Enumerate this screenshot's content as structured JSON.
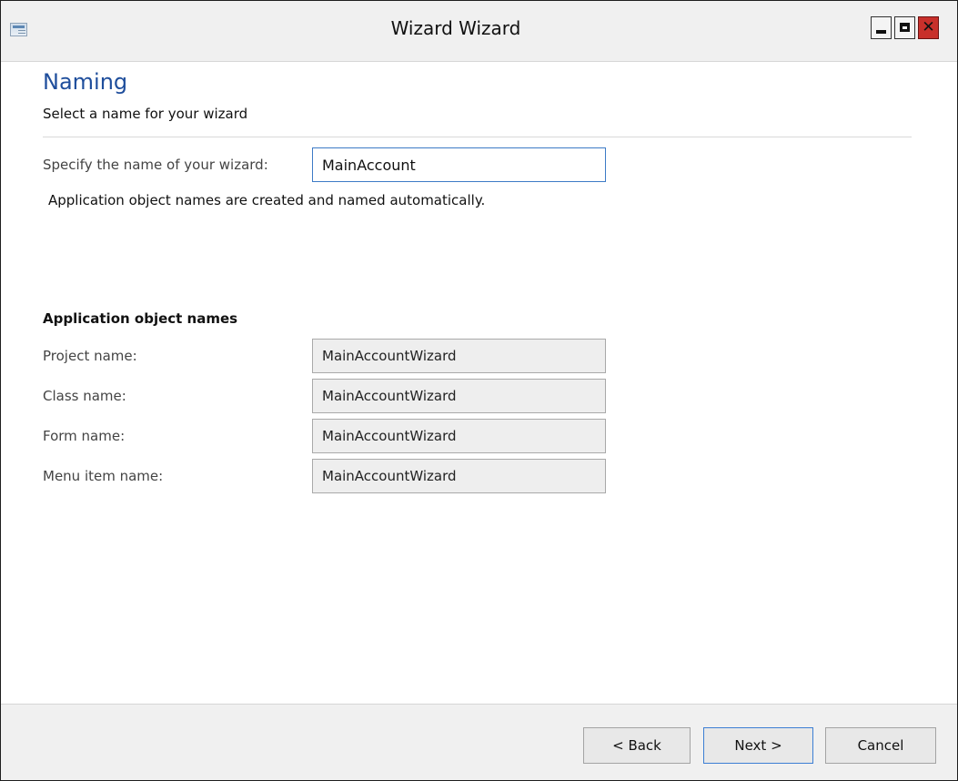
{
  "window": {
    "title": "Wizard Wizard",
    "controls": {
      "minimize_icon": "minimize-icon",
      "maximize_icon": "maximize-icon",
      "close_icon": "close-icon",
      "close_glyph": "✕",
      "close_color": "#c8302b"
    }
  },
  "page": {
    "heading": "Naming",
    "subheading": "Select a name for your wizard",
    "heading_color": "#1f4e9c"
  },
  "name_field": {
    "label": "Specify the name of your wizard:",
    "value": "MainAccount"
  },
  "info_text": "Application object names are created and named automatically.",
  "object_names": {
    "title": "Application object names",
    "fields": [
      {
        "label": "Project name:",
        "value": "MainAccountWizard"
      },
      {
        "label": "Class name:",
        "value": "MainAccountWizard"
      },
      {
        "label": "Form name:",
        "value": "MainAccountWizard"
      },
      {
        "label": "Menu item name:",
        "value": "MainAccountWizard"
      }
    ]
  },
  "footer": {
    "back_label": "< Back",
    "next_label": "Next >",
    "cancel_label": "Cancel"
  }
}
